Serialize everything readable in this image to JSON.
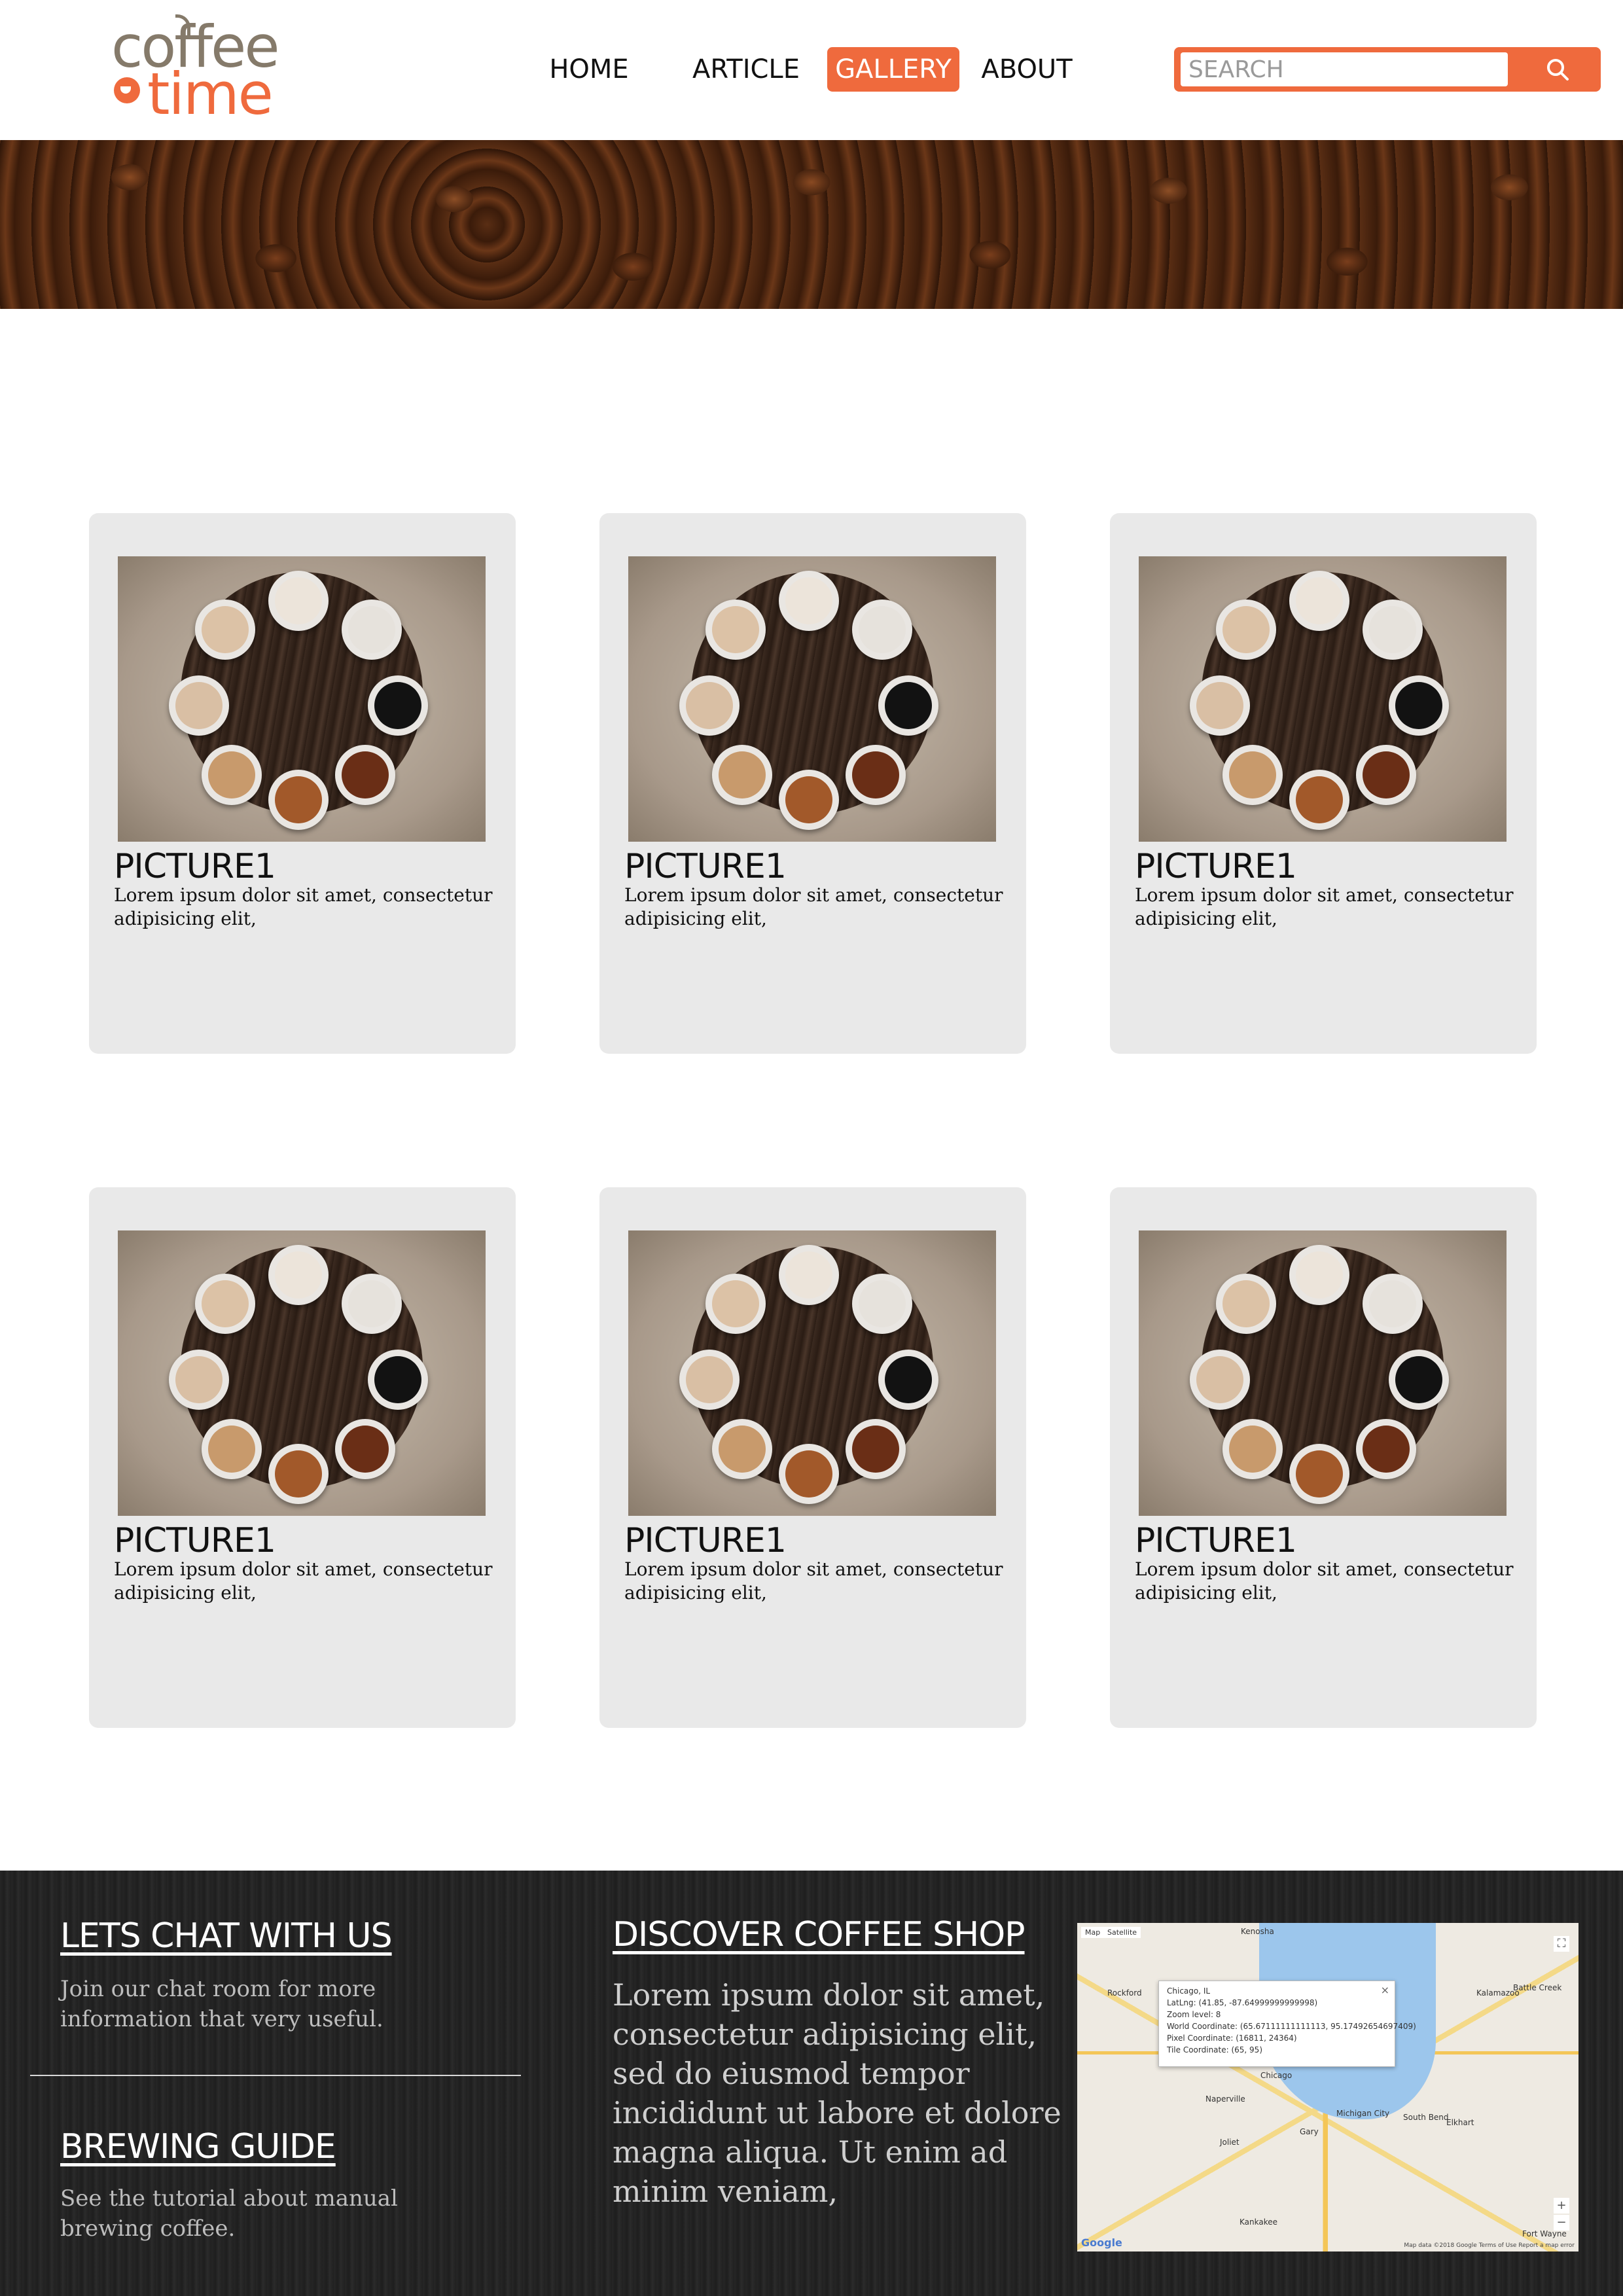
{
  "header": {
    "logo": {
      "word1": "coffee",
      "word2": "time"
    },
    "nav": [
      {
        "label": "HOME",
        "active": false
      },
      {
        "label": "ARTICLE",
        "active": false
      },
      {
        "label": "GALLERY",
        "active": true
      },
      {
        "label": "ABOUT",
        "active": false
      }
    ],
    "search": {
      "placeholder": "SEARCH",
      "icon": "search-icon"
    }
  },
  "gallery": {
    "cards": [
      {
        "title": "PICTURE1",
        "desc": "Lorem ipsum dolor sit amet, consectetur adipisicing elit,"
      },
      {
        "title": "PICTURE1",
        "desc": "Lorem ipsum dolor sit amet, consectetur adipisicing elit,"
      },
      {
        "title": "PICTURE1",
        "desc": "Lorem ipsum dolor sit amet, consectetur adipisicing elit,"
      },
      {
        "title": "PICTURE1",
        "desc": "Lorem ipsum dolor sit amet, consectetur adipisicing elit,"
      },
      {
        "title": "PICTURE1",
        "desc": "Lorem ipsum dolor sit amet, consectetur adipisicing elit,"
      },
      {
        "title": "PICTURE1",
        "desc": "Lorem ipsum dolor sit amet, consectetur adipisicing elit,"
      }
    ]
  },
  "footer": {
    "chat": {
      "heading": "LETS CHAT WITH US",
      "text": "Join our chat room for more information that very useful."
    },
    "brew": {
      "heading": "BREWING GUIDE",
      "text": "See the tutorial about manual brewing coffee."
    },
    "discover": {
      "heading": "DISCOVER COFFEE SHOP",
      "text": "Lorem ipsum dolor sit amet, consectetur adipisicing elit, sed do eiusmod tempor incididunt ut labore et dolore magna aliqua. Ut enim ad minim veniam,"
    },
    "map": {
      "tabs": [
        "Map",
        "Satellite"
      ],
      "popup": [
        "Chicago, IL",
        "LatLng: (41.85, -87.64999999999998)",
        "Zoom level: 8",
        "World Coordinate: (65.67111111111113, 95.17492654697409)",
        "Pixel Coordinate: (16811, 24364)",
        "Tile Coordinate: (65, 95)"
      ],
      "close": "×",
      "cities": [
        "Kenosha",
        "Rockford",
        "Naperville",
        "Chicago",
        "Joliet",
        "Gary",
        "Kalamazoo",
        "Battle Creek",
        "South Bend",
        "Elkhart",
        "Kankakee",
        "Fort Wayne",
        "Michigan City"
      ],
      "zoom_in": "+",
      "zoom_out": "−",
      "google": "Google",
      "attribution": "Map data ©2018 Google   Terms of Use   Report a map error"
    }
  },
  "colors": {
    "accent": "#ef6a3d",
    "logo_brown": "#857a6a",
    "card_bg": "#e9e9e9",
    "footer_bg": "#232323"
  }
}
